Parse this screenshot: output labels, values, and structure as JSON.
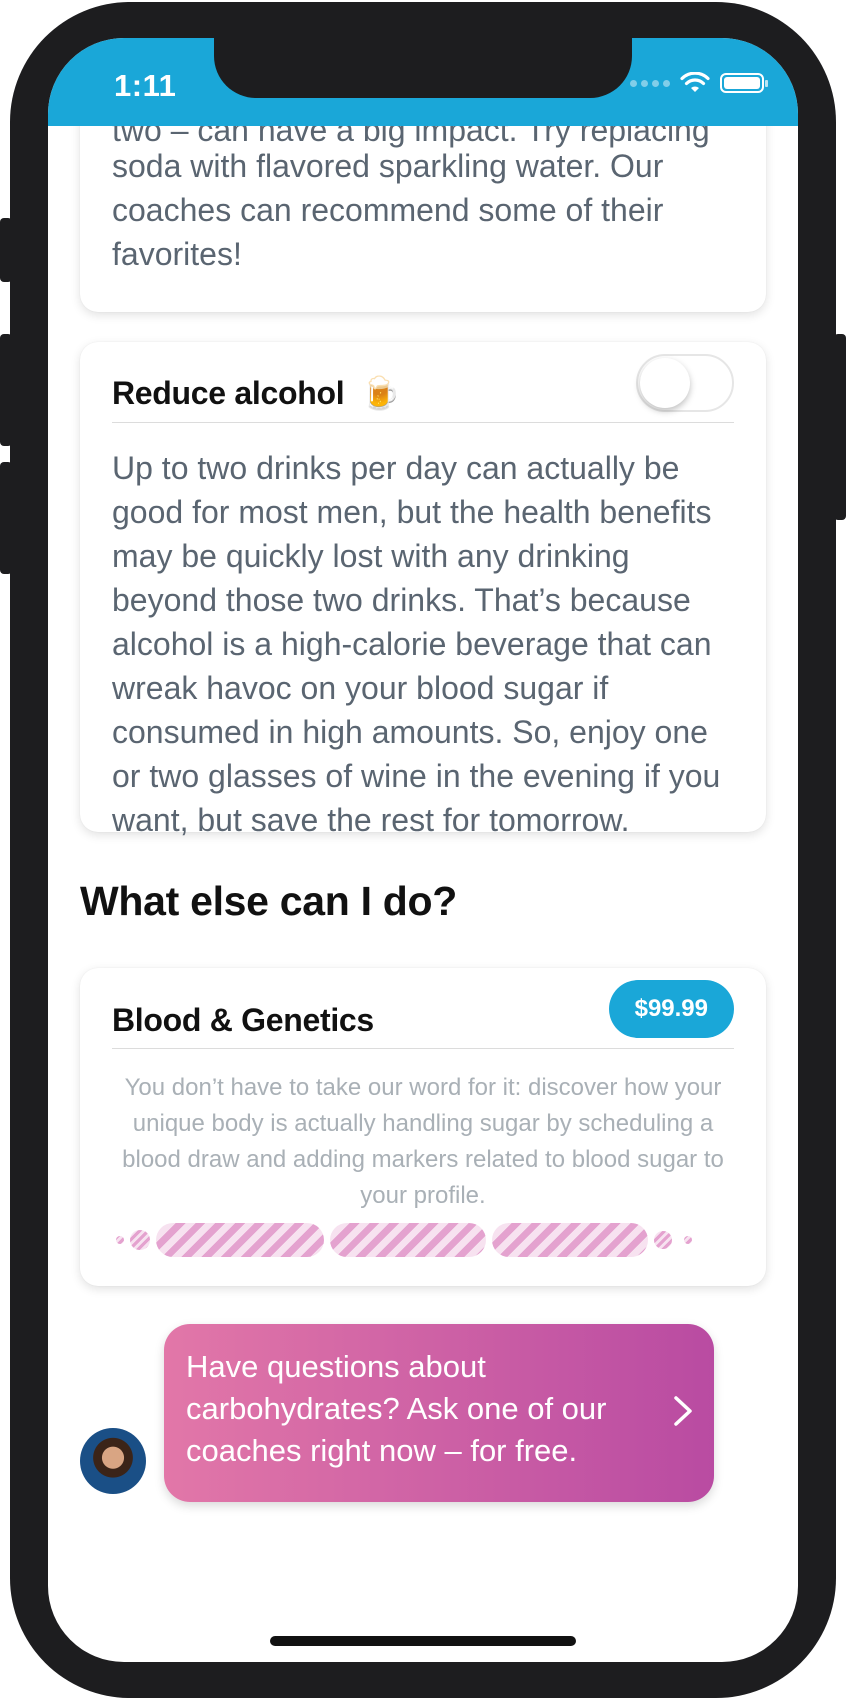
{
  "status_bar": {
    "time": "1:11"
  },
  "top_card": {
    "text_clipped": "two – can have a big impact. Try replacing",
    "text": "soda with flavored sparkling water. Our coaches can recommend some of their favorites!"
  },
  "alcohol_card": {
    "title": "Reduce alcohol",
    "emoji": "🍺",
    "toggle_on": false,
    "body": "Up to two drinks per day can actually be good for most men, but the health benefits may be quickly lost with any drinking beyond those two drinks. That’s because alcohol is a high-calorie beverage that can wreak havoc on your blood sugar if consumed in high amounts. So, enjoy one or two glasses of wine in the evening if you want, but save the rest for tomorrow."
  },
  "section": {
    "heading": "What else can I do?"
  },
  "blood_card": {
    "title": "Blood & Genetics",
    "price": "$99.99",
    "description": "You don’t have to take our word for it: discover how your unique body is actually handling sugar by scheduling a blood draw and adding markers related to blood sugar to your profile."
  },
  "coach_cta": {
    "text": "Have questions about carbohydrates? Ask one of our coaches right now – for free.",
    "icon": "chevron-right-icon"
  },
  "colors": {
    "accent": "#1aa7d8",
    "cta_start": "#e277a8",
    "cta_end": "#b94ba2"
  }
}
